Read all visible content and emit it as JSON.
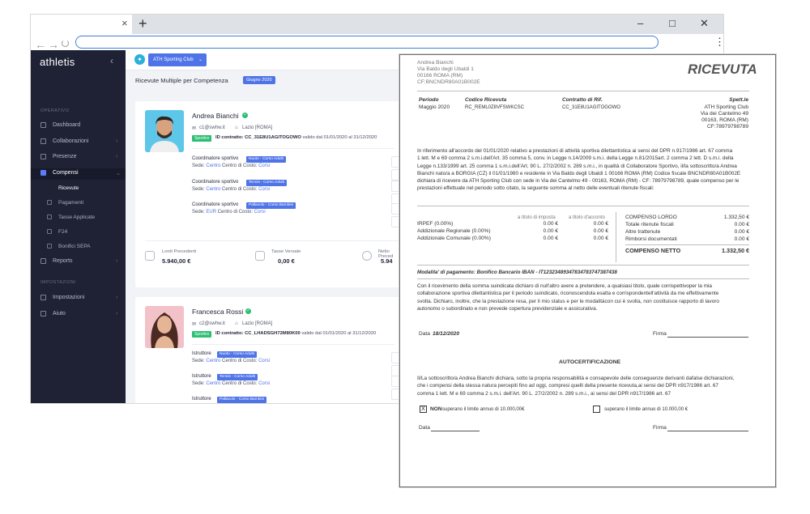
{
  "browser": {
    "tab_close": "×",
    "new_tab": "+",
    "minimize": "–",
    "maximize": "□",
    "close": "✕",
    "back": "←",
    "forward": "→",
    "reload": "C",
    "menu": "⋮"
  },
  "sidebar": {
    "logo": "athletis",
    "collapse": "‹",
    "section_operativo": "OPERATIVO",
    "section_impostazioni": "IMPOSTAZIONI",
    "items": {
      "dashboard": "Dashboard",
      "collaborazioni": "Collaborazioni",
      "presenze": "Presenze",
      "compensi": "Compensi",
      "ricevute": "Ricevute",
      "pagamenti": "Pagamenti",
      "tasse": "Tasse Applicate",
      "f24": "F24",
      "bonifici": "Bonifici SEPA",
      "reports": "Reports",
      "impostazioni": "Impostazioni",
      "aiuto": "Aiuto"
    }
  },
  "appbar": {
    "club": "ATH Sporting Club",
    "club_arrow": "⌄",
    "page_title": "Ricevute Multiple per Competenza",
    "month": "Giugno 2020"
  },
  "people": [
    {
      "name": "Andrea Bianchi",
      "email": "c1@swhw.it",
      "location": "Lazio [ROMA]",
      "badge": "Sportivo",
      "contract_label": "ID contratto:",
      "contract_id": "CC_31E8U1AGITOGOWO",
      "validity": "valido dal 01/01/2020 al 31/12/2020",
      "roles": [
        {
          "role": "Coordinatore sportivo",
          "course": "Nuoto - Corso Adulti",
          "sede_label": "Sede:",
          "sede": "Centro",
          "cdc_label": "Centro di Costo:",
          "cdc": "Corsi"
        },
        {
          "role": "Coordinatore sportivo",
          "course": "Tennis - Corso Adulti",
          "sede_label": "Sede:",
          "sede": "Centro",
          "cdc_label": "Centro di Costo:",
          "cdc": "Corsi"
        },
        {
          "role": "Coordinatore sportivo",
          "course": "Pallavolo - Corso Bambini",
          "sede_label": "Sede:",
          "sede": "EUR",
          "cdc_label": "Centro di Costo:",
          "cdc": "Corsi"
        }
      ],
      "totals": {
        "lordi_label": "Lordi Precedenti",
        "lordi": "5.940,00 €",
        "tasse_label": "Tasse Versate",
        "tasse": "0,00 €",
        "netto_label": "Netto Preced",
        "netto": "5.94"
      }
    },
    {
      "name": "Francesca Rossi",
      "email": "c2@swhw.it",
      "location": "Lazio [ROMA]",
      "badge": "Sportivo",
      "contract_label": "ID contratto:",
      "contract_id": "CC_LHADSGH72M80K00",
      "validity": "valido dal 01/01/2020 al 31/12/2020",
      "roles": [
        {
          "role": "Istruttore",
          "course": "Nuoto - Corso Adulti",
          "sede_label": "Sede:",
          "sede": "Centro",
          "cdc_label": "Centro di Costo:",
          "cdc": "Corsi"
        },
        {
          "role": "Istruttore",
          "course": "Tennis - Corso Adulti",
          "sede_label": "Sede:",
          "sede": "Centro",
          "cdc_label": "Centro di Costo:",
          "cdc": "Corsi"
        },
        {
          "role": "Istruttore",
          "course": "Pallavolo - Corso Bambini",
          "sede_label": "",
          "sede": "",
          "cdc_label": "",
          "cdc": ""
        }
      ]
    }
  ],
  "receipt": {
    "title": "RICEVUTA",
    "sender": [
      "Andrea Bianchi",
      "Via Baldo degli Ubaldi 1",
      "00166 ROMA (RM)",
      "CF:BNCNDR80A01B002E"
    ],
    "cols": {
      "periodo_h": "Periodo",
      "periodo": "Maggio 2020",
      "codice_h": "Codice Ricevuta",
      "codice": "RC_REML0Z8VFSWKCSC",
      "contratto_h": "Contratto di Rif.",
      "contratto": "CC_31E8U1AGITOGOWO",
      "spett_h": "Spett.le",
      "spett": [
        "ATH Sporting Club",
        "Via dei Cantelmo 49",
        "00163, ROMA (RM)",
        "CF:78979798789"
      ]
    },
    "body": [
      "In riferimento all'accordo del 01/01/2020 relativo a prestazioni di attività sportiva dilettantistica ai sensi del DPR n.917/1986 art. 67 comma",
      "1 lett. M e 69 comma 2 s.m.i.dell'Art. 35 comma 5, conv. in Legge n.14/2009 s.m.i. della Legge n.81/2015art. 2 comma 2 lett. D s.m.i. della",
      "Legge n.133/1999 art. 25 comma 1 s.m.i.dell'Art. 90 L. 27/2/2002 n. 289 s.m.i., in qualità di Collaboratore Sportivo, il/la sottoscritto/a Andrea",
      "Bianchi nato/a a BORGIA (CZ) il 01/01/1980 e residente in Via Baldo degli Ubaldi 1 00166 ROMA (RM) Codice fiscale BNCNDR80A01B002E",
      "dichiara di ricevere da ATH Sporting Club con sede in Via dei Cantelmo 49 - 00163, ROMA (RM) - CF: 78979798789, quale compenso per le",
      "prestazioni effettuate nel periodo sotto citato, la seguente somma al netto delle eventuali ritenute fiscali:"
    ],
    "tax_table": {
      "h1": "a titolo di imposta",
      "h2": "a titolo d'acconto",
      "rows": [
        {
          "label": "IRPEF (0.00%)",
          "a": "0.00 €",
          "b": "0.00 €"
        },
        {
          "label": "Addizionale Regionale (0.00%)",
          "a": "0.00 €",
          "b": "0.00 €"
        },
        {
          "label": "Addizionale Comunale (0.00%)",
          "a": "0.00 €",
          "b": "0.00 €"
        }
      ]
    },
    "totals": [
      {
        "label": "COMPENSO LORDO",
        "value": "1.332,50 €"
      },
      {
        "label": "Totale ritenute fiscali",
        "value": "0.00 €"
      },
      {
        "label": "Altre trattenute",
        "value": "0.00 €"
      },
      {
        "label": "Rimborsi documentati",
        "value": "0.00 €"
      }
    ],
    "netto_label": "COMPENSO NETTO",
    "netto_value": "1.332,50 €",
    "payment": "Modalita' di pagamento: Bonifico Bancario IBAN - IT12323489347834783747387438",
    "declaration": [
      "Con il ricevimento della somma suindicata dichiaro di null'altro avere a pretendere, a qualsiasi titolo, quale corrispettivoper la mia",
      "collaborazione sportiva dilettantistica per il periodo suindicato, riconoscendola esatta e corrispondentell'attività da me effettivamente",
      "svolta. Dichiaro, inoltre, che la prestazione resa, per il mio status e per le modalitàcon cui è svolta, non costituisce rapporto di lavoro",
      "autonomo o subordinato e non prevede copertura previdenziale e assicurativa."
    ],
    "data_label": "Data",
    "data_value": "18/12/2020",
    "firma_label": "Firma",
    "auto_title": "AUTOCERTIFICAZIONE",
    "auto_text": [
      "Il/La sottoscritto/a Andrea Bianchi dichiara, sotto la propria responsabilità e consapevole delle conseguenze derivanti dafalse dichiarazioni,",
      "che i compensi della stessa natura percepiti fino ad oggi, compresi quelli della presente ricevuta,ai sensi del DPR n917/1986 art. 67",
      "comma 1 lett. M e 69 comma 2 s.m.i. dell'Art. 90 L. 27/2/2002 n. 289 s.m.i., ai sensi del DPR n917/1986 art. 67"
    ],
    "non_label": "NON",
    "non_text": "superano il limite annuo di 10.000,00€",
    "super_text": "superano il limite annuo di 10.000,00 €",
    "check_mark": "X"
  }
}
